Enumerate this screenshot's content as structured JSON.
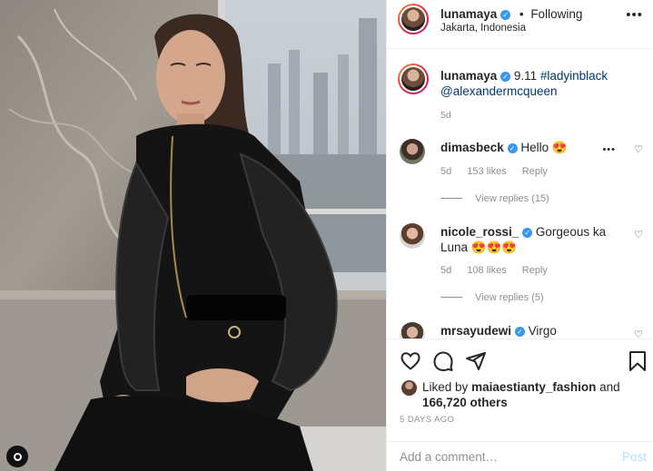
{
  "post": {
    "author": "lunamaya",
    "follow_separator": "•",
    "follow_status": "Following",
    "location": "Jakarta, Indonesia",
    "more_icon": "more-horizontal-icon"
  },
  "caption": {
    "username": "lunamaya",
    "text_prefix": "9.11",
    "hashtag": "#ladyinblack",
    "mention": "@alexandermcqueen",
    "time": "5d"
  },
  "comments": [
    {
      "username": "dimasbeck",
      "text": "Hello 😍",
      "time": "5d",
      "likes": "153 likes",
      "reply": "Reply",
      "view_replies": "View replies (15)"
    },
    {
      "username": "nicole_rossi_",
      "text": "Gorgeous ka",
      "text_line2": "Luna 😍😍😍",
      "time": "5d",
      "likes": "108 likes",
      "reply": "Reply",
      "view_replies": "View replies (5)"
    },
    {
      "username": "mrsayudewi",
      "text": "Virgo"
    }
  ],
  "actions": {
    "like_icon": "heart-icon",
    "comment_icon": "comment-icon",
    "share_icon": "share-icon",
    "save_icon": "bookmark-icon"
  },
  "likes": {
    "prefix": "Liked by",
    "user": "maiaestianty_fashion",
    "joiner": "and",
    "others": "166,720 others"
  },
  "date": "5 DAYS AGO",
  "comment_box": {
    "placeholder": "Add a comment…",
    "post_label": "Post"
  },
  "colors": {
    "link": "#00376b",
    "verified": "#3897f0",
    "muted": "#8e8e8e",
    "post_disabled": "#b2dffc"
  }
}
